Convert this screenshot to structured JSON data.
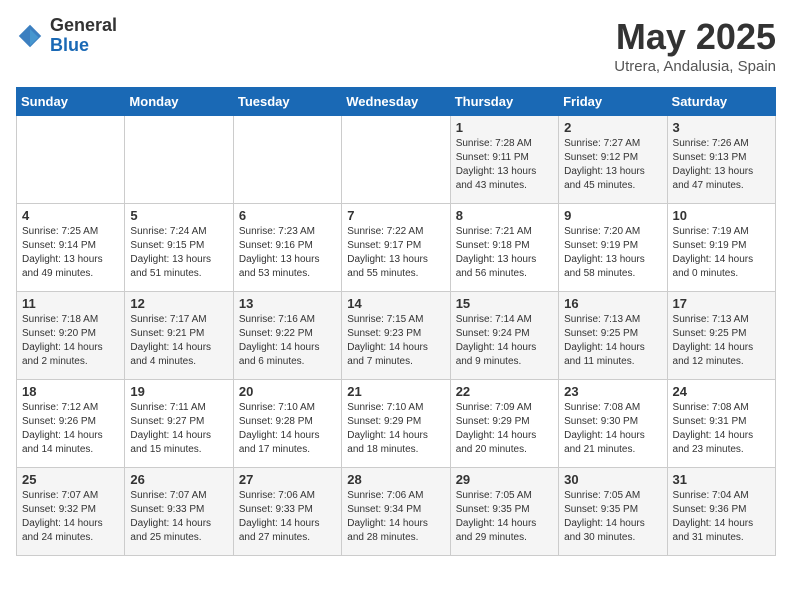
{
  "header": {
    "logo_general": "General",
    "logo_blue": "Blue",
    "month_year": "May 2025",
    "location": "Utrera, Andalusia, Spain"
  },
  "days_of_week": [
    "Sunday",
    "Monday",
    "Tuesday",
    "Wednesday",
    "Thursday",
    "Friday",
    "Saturday"
  ],
  "weeks": [
    [
      {
        "day": "",
        "info": ""
      },
      {
        "day": "",
        "info": ""
      },
      {
        "day": "",
        "info": ""
      },
      {
        "day": "",
        "info": ""
      },
      {
        "day": "1",
        "info": "Sunrise: 7:28 AM\nSunset: 9:11 PM\nDaylight: 13 hours\nand 43 minutes."
      },
      {
        "day": "2",
        "info": "Sunrise: 7:27 AM\nSunset: 9:12 PM\nDaylight: 13 hours\nand 45 minutes."
      },
      {
        "day": "3",
        "info": "Sunrise: 7:26 AM\nSunset: 9:13 PM\nDaylight: 13 hours\nand 47 minutes."
      }
    ],
    [
      {
        "day": "4",
        "info": "Sunrise: 7:25 AM\nSunset: 9:14 PM\nDaylight: 13 hours\nand 49 minutes."
      },
      {
        "day": "5",
        "info": "Sunrise: 7:24 AM\nSunset: 9:15 PM\nDaylight: 13 hours\nand 51 minutes."
      },
      {
        "day": "6",
        "info": "Sunrise: 7:23 AM\nSunset: 9:16 PM\nDaylight: 13 hours\nand 53 minutes."
      },
      {
        "day": "7",
        "info": "Sunrise: 7:22 AM\nSunset: 9:17 PM\nDaylight: 13 hours\nand 55 minutes."
      },
      {
        "day": "8",
        "info": "Sunrise: 7:21 AM\nSunset: 9:18 PM\nDaylight: 13 hours\nand 56 minutes."
      },
      {
        "day": "9",
        "info": "Sunrise: 7:20 AM\nSunset: 9:19 PM\nDaylight: 13 hours\nand 58 minutes."
      },
      {
        "day": "10",
        "info": "Sunrise: 7:19 AM\nSunset: 9:19 PM\nDaylight: 14 hours\nand 0 minutes."
      }
    ],
    [
      {
        "day": "11",
        "info": "Sunrise: 7:18 AM\nSunset: 9:20 PM\nDaylight: 14 hours\nand 2 minutes."
      },
      {
        "day": "12",
        "info": "Sunrise: 7:17 AM\nSunset: 9:21 PM\nDaylight: 14 hours\nand 4 minutes."
      },
      {
        "day": "13",
        "info": "Sunrise: 7:16 AM\nSunset: 9:22 PM\nDaylight: 14 hours\nand 6 minutes."
      },
      {
        "day": "14",
        "info": "Sunrise: 7:15 AM\nSunset: 9:23 PM\nDaylight: 14 hours\nand 7 minutes."
      },
      {
        "day": "15",
        "info": "Sunrise: 7:14 AM\nSunset: 9:24 PM\nDaylight: 14 hours\nand 9 minutes."
      },
      {
        "day": "16",
        "info": "Sunrise: 7:13 AM\nSunset: 9:25 PM\nDaylight: 14 hours\nand 11 minutes."
      },
      {
        "day": "17",
        "info": "Sunrise: 7:13 AM\nSunset: 9:25 PM\nDaylight: 14 hours\nand 12 minutes."
      }
    ],
    [
      {
        "day": "18",
        "info": "Sunrise: 7:12 AM\nSunset: 9:26 PM\nDaylight: 14 hours\nand 14 minutes."
      },
      {
        "day": "19",
        "info": "Sunrise: 7:11 AM\nSunset: 9:27 PM\nDaylight: 14 hours\nand 15 minutes."
      },
      {
        "day": "20",
        "info": "Sunrise: 7:10 AM\nSunset: 9:28 PM\nDaylight: 14 hours\nand 17 minutes."
      },
      {
        "day": "21",
        "info": "Sunrise: 7:10 AM\nSunset: 9:29 PM\nDaylight: 14 hours\nand 18 minutes."
      },
      {
        "day": "22",
        "info": "Sunrise: 7:09 AM\nSunset: 9:29 PM\nDaylight: 14 hours\nand 20 minutes."
      },
      {
        "day": "23",
        "info": "Sunrise: 7:08 AM\nSunset: 9:30 PM\nDaylight: 14 hours\nand 21 minutes."
      },
      {
        "day": "24",
        "info": "Sunrise: 7:08 AM\nSunset: 9:31 PM\nDaylight: 14 hours\nand 23 minutes."
      }
    ],
    [
      {
        "day": "25",
        "info": "Sunrise: 7:07 AM\nSunset: 9:32 PM\nDaylight: 14 hours\nand 24 minutes."
      },
      {
        "day": "26",
        "info": "Sunrise: 7:07 AM\nSunset: 9:33 PM\nDaylight: 14 hours\nand 25 minutes."
      },
      {
        "day": "27",
        "info": "Sunrise: 7:06 AM\nSunset: 9:33 PM\nDaylight: 14 hours\nand 27 minutes."
      },
      {
        "day": "28",
        "info": "Sunrise: 7:06 AM\nSunset: 9:34 PM\nDaylight: 14 hours\nand 28 minutes."
      },
      {
        "day": "29",
        "info": "Sunrise: 7:05 AM\nSunset: 9:35 PM\nDaylight: 14 hours\nand 29 minutes."
      },
      {
        "day": "30",
        "info": "Sunrise: 7:05 AM\nSunset: 9:35 PM\nDaylight: 14 hours\nand 30 minutes."
      },
      {
        "day": "31",
        "info": "Sunrise: 7:04 AM\nSunset: 9:36 PM\nDaylight: 14 hours\nand 31 minutes."
      }
    ]
  ]
}
